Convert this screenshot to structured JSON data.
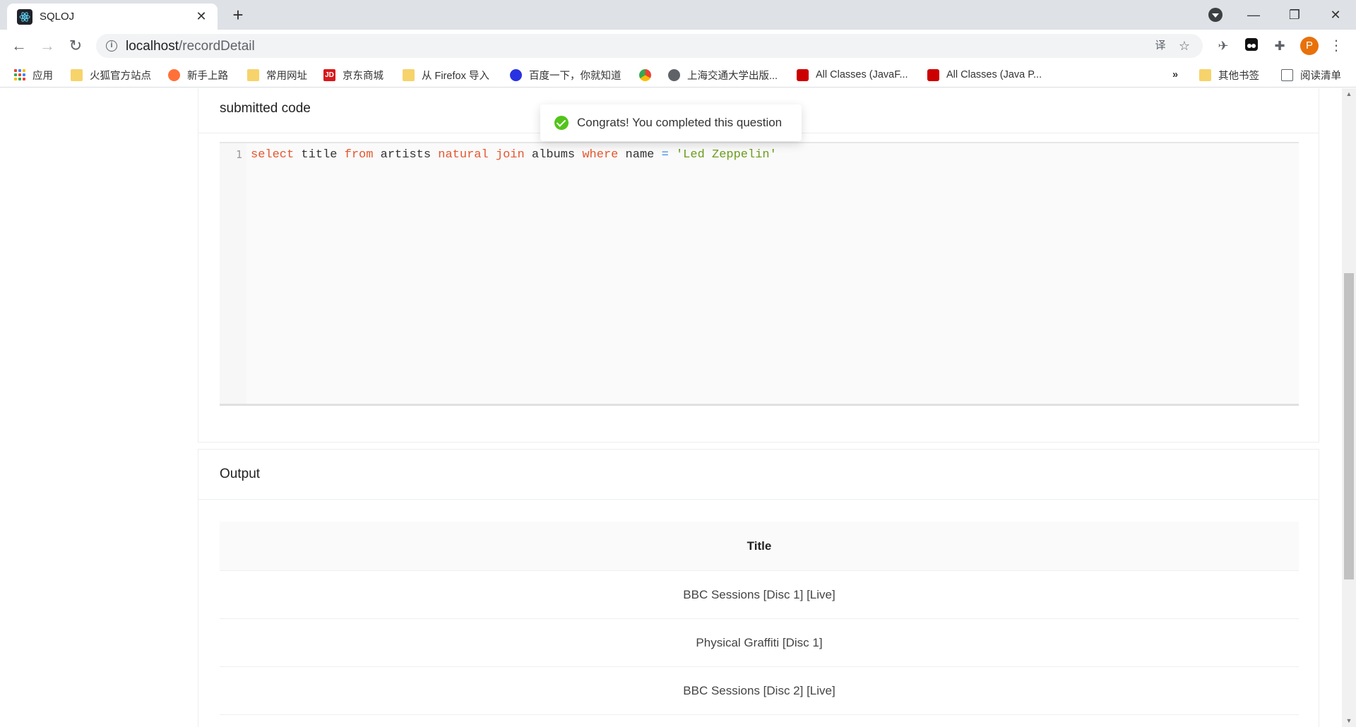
{
  "browser": {
    "tab_title": "SQLOJ",
    "url_host": "localhost",
    "url_path": "/recordDetail",
    "avatar_letter": "P"
  },
  "bookmarks": {
    "apps": "应用",
    "items": [
      "火狐官方站点",
      "新手上路",
      "常用网址",
      "京东商城",
      "从 Firefox 导入",
      "百度一下，你就知道",
      "上海交通大学出版...",
      "All Classes (JavaF...",
      "All Classes (Java P..."
    ],
    "overflow": "»",
    "other": "其他书签",
    "reading_list": "阅读清单"
  },
  "code_card": {
    "title": "submitted code",
    "line_number": "1",
    "tokens": [
      {
        "t": "select",
        "k": "kw"
      },
      {
        "t": " title ",
        "k": "plain"
      },
      {
        "t": "from",
        "k": "kw"
      },
      {
        "t": " artists ",
        "k": "plain"
      },
      {
        "t": "natural",
        "k": "kw"
      },
      {
        "t": " ",
        "k": "plain"
      },
      {
        "t": "join",
        "k": "kw"
      },
      {
        "t": " albums ",
        "k": "plain"
      },
      {
        "t": "where",
        "k": "kw"
      },
      {
        "t": " name ",
        "k": "plain"
      },
      {
        "t": "=",
        "k": "op"
      },
      {
        "t": " ",
        "k": "plain"
      },
      {
        "t": "'Led Zeppelin'",
        "k": "str"
      }
    ]
  },
  "toast": {
    "message": "Congrats! You completed this question"
  },
  "output": {
    "title": "Output",
    "column": "Title",
    "rows": [
      "BBC Sessions [Disc 1] [Live]",
      "Physical Graffiti [Disc 1]",
      "BBC Sessions [Disc 2] [Live]"
    ]
  },
  "colors": {
    "success": "#52c41a",
    "keyword": "#e4572e",
    "string": "#6a9c1b",
    "avatar": "#e8710a"
  }
}
